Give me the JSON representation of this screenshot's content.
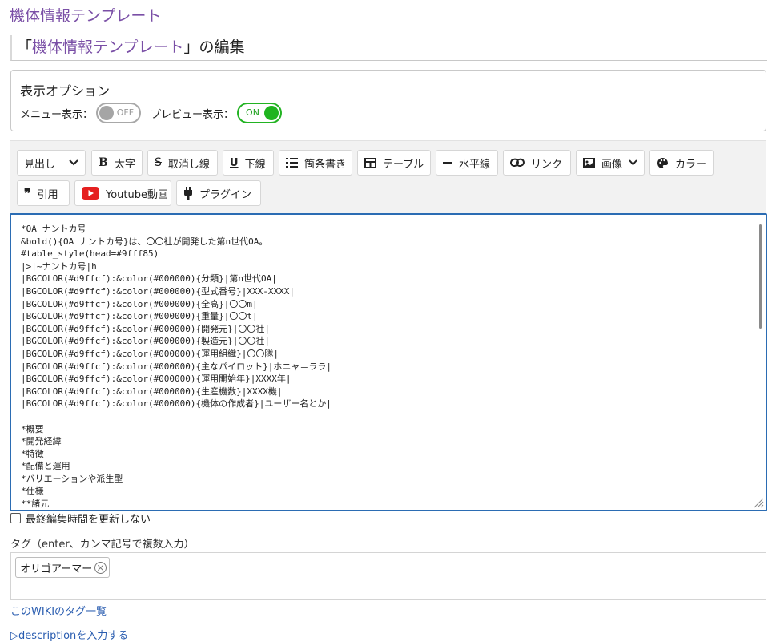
{
  "header": {
    "title": "機体情報テンプレート"
  },
  "edit_title": {
    "open_quote": "「",
    "page_name": "機体情報テンプレート",
    "suffix": "」の編集"
  },
  "options": {
    "heading": "表示オプション",
    "menu_label": "メニュー表示：",
    "menu_toggle": "OFF",
    "preview_label": "プレビュー表示：",
    "preview_toggle": "ON"
  },
  "toolbar": {
    "heading_select": "見出し",
    "bold": "太字",
    "strike": "取消し線",
    "underline": "下線",
    "list": "箇条書き",
    "table": "テーブル",
    "hr": "水平線",
    "link": "リンク",
    "image": "画像",
    "color": "カラー",
    "quote": "引用",
    "youtube": "Youtube動画",
    "plugin": "プラグイン"
  },
  "editor": {
    "content": "*OA ナントカ号\n&bold(){OA ナントカ号}は、〇〇社が開発した第n世代OA。\n#table_style(head=#9fff85)\n|>|~ナントカ号|h\n|BGCOLOR(#d9ffcf):&color(#000000){分類}|第n世代OA|\n|BGCOLOR(#d9ffcf):&color(#000000){型式番号}|XXX-XXXX|\n|BGCOLOR(#d9ffcf):&color(#000000){全高}|〇〇m|\n|BGCOLOR(#d9ffcf):&color(#000000){重量}|〇〇t|\n|BGCOLOR(#d9ffcf):&color(#000000){開発元}|〇〇社|\n|BGCOLOR(#d9ffcf):&color(#000000){製造元}|〇〇社|\n|BGCOLOR(#d9ffcf):&color(#000000){運用組織}|〇〇隊|\n|BGCOLOR(#d9ffcf):&color(#000000){主なパイロット}|ホニャ＝ララ|\n|BGCOLOR(#d9ffcf):&color(#000000){運用開始年}|XXXX年|\n|BGCOLOR(#d9ffcf):&color(#000000){生産機数}|XXXX機|\n|BGCOLOR(#d9ffcf):&color(#000000){機体の作成者}|ユーザー名とか|\n\n*概要\n*開発経緯\n*特徴\n*配備と運用\n*バリエーションや派生型\n*仕様\n**諸元"
  },
  "no_update_checkbox": "最終編集時間を更新しない",
  "tags": {
    "label": "タグ（enter、カンマ記号で複数入力）",
    "items": [
      "オリゴアーマー"
    ]
  },
  "wiki_tags_link": "このWIKIのタグ一覧",
  "description_link": "▷descriptionを入力する"
}
